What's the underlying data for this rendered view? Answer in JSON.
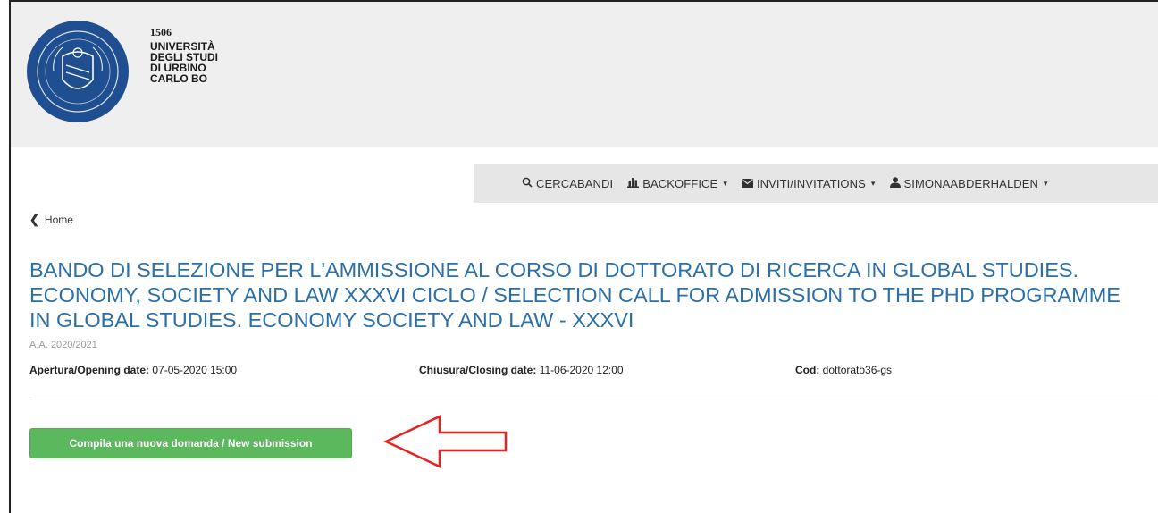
{
  "brand": {
    "year": "1506",
    "line1": "UNIVERSITÀ",
    "line2": "DEGLI STUDI",
    "line3": "DI URBINO",
    "line4": "CARLO BO",
    "seal_color": "#1f4e91"
  },
  "navbar": {
    "items": [
      {
        "label": "CERCABANDI",
        "icon": "search-icon",
        "dropdown": false
      },
      {
        "label": "BACKOFFICE",
        "icon": "bar-chart-icon",
        "dropdown": true
      },
      {
        "label": "INVITI/INVITATIONS",
        "icon": "envelope-icon",
        "dropdown": true
      },
      {
        "label": "SIMONAABDERHALDEN",
        "icon": "user-icon",
        "dropdown": true
      }
    ]
  },
  "breadcrumb": {
    "home_label": "Home"
  },
  "call": {
    "title": "BANDO DI SELEZIONE PER L'AMMISSIONE AL CORSO DI DOTTORATO DI RICERCA IN GLOBAL STUDIES. ECONOMY, SOCIETY AND LAW XXXVI CICLO / SELECTION CALL FOR ADMISSION TO THE PHD PROGRAMME IN GLOBAL STUDIES. ECONOMY SOCIETY AND LAW - XXXVI",
    "academic_year": "A.A. 2020/2021",
    "opening_label": "Apertura/Opening date:",
    "opening_value": "07-05-2020 15:00",
    "closing_label": "Chiusura/Closing date:",
    "closing_value": "11-06-2020 12:00",
    "code_label": "Cod:",
    "code_value": "dottorato36-gs"
  },
  "actions": {
    "new_submission_label": "Compila una nuova domanda / New submission"
  },
  "colors": {
    "title": "#2a6fa8",
    "button": "#5cb85c",
    "arrow": "#e8201e"
  }
}
